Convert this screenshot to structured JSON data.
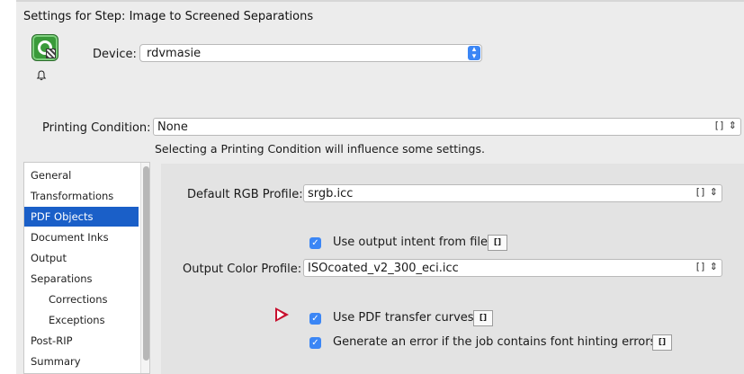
{
  "window": {
    "title": "Settings for Step: Image to Screened Separations"
  },
  "device": {
    "label": "Device:",
    "value": "rdvmasie"
  },
  "printing_condition": {
    "label": "Printing Condition:",
    "value": "None",
    "hint": "Selecting a Printing Condition will influence some settings."
  },
  "sidebar": {
    "items": [
      {
        "label": "General",
        "selected": false,
        "indent": false
      },
      {
        "label": "Transformations",
        "selected": false,
        "indent": false
      },
      {
        "label": "PDF Objects",
        "selected": true,
        "indent": false
      },
      {
        "label": "Document Inks",
        "selected": false,
        "indent": false
      },
      {
        "label": "Output",
        "selected": false,
        "indent": false
      },
      {
        "label": "Separations",
        "selected": false,
        "indent": false
      },
      {
        "label": "Corrections",
        "selected": false,
        "indent": true
      },
      {
        "label": "Exceptions",
        "selected": false,
        "indent": true
      },
      {
        "label": "Post-RIP",
        "selected": false,
        "indent": false
      },
      {
        "label": "Summary",
        "selected": false,
        "indent": false
      }
    ]
  },
  "panel": {
    "rgb_profile_label": "Default RGB Profile:",
    "rgb_profile_value": "srgb.icc",
    "use_output_intent_label": "Use output intent from file",
    "use_output_intent_checked": true,
    "output_profile_label": "Output Color Profile:",
    "output_profile_value": "ISOcoated_v2_300_eci.icc",
    "use_transfer_curves_label": "Use PDF transfer curves",
    "use_transfer_curves_checked": true,
    "font_hinting_error_label": "Generate an error if the job contains font hinting errors",
    "font_hinting_error_checked": true
  },
  "icons": {
    "checkmark": "✓",
    "param": "[]",
    "stepper": "⌃⌄",
    "bell": "🔔"
  },
  "colors": {
    "selection": "#1a5fc8",
    "checkbox": "#3b86f5",
    "annotation_arrow": "#c8102e"
  }
}
